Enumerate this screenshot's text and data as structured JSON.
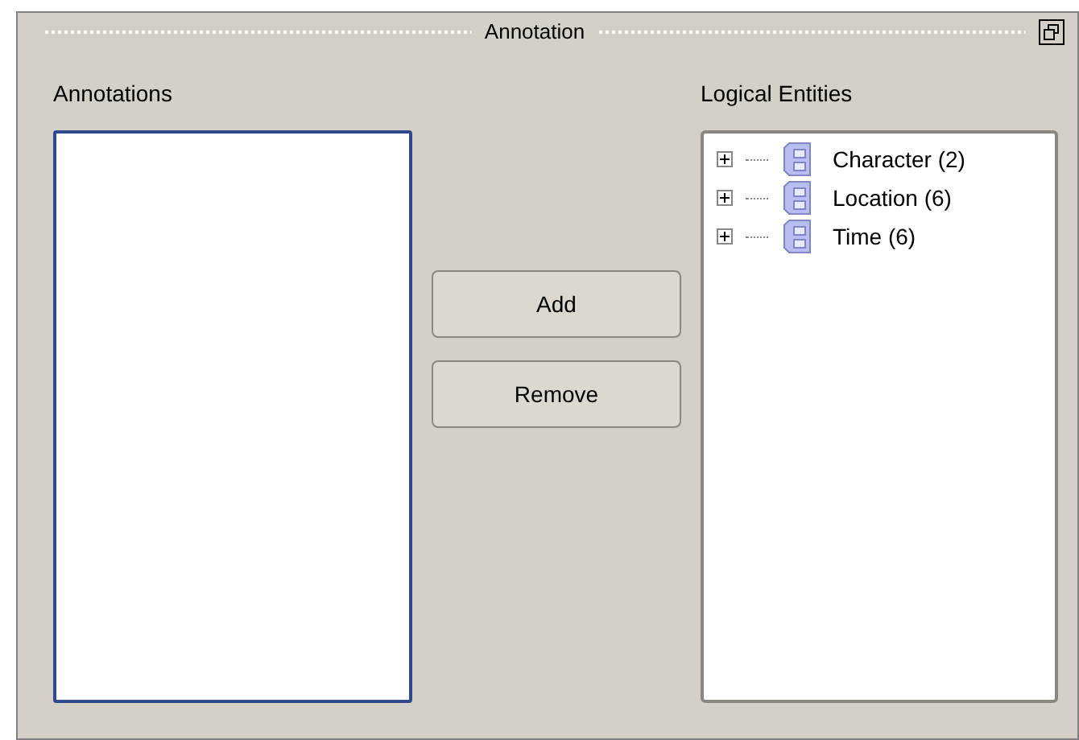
{
  "window": {
    "title": "Annotation"
  },
  "annotations": {
    "label": "Annotations"
  },
  "buttons": [
    "Add",
    "Remove"
  ],
  "logical_entities": {
    "label": "Logical Entities",
    "items": [
      {
        "label": "Character (2)",
        "expanded": false
      },
      {
        "label": "Location (6)",
        "expanded": false
      },
      {
        "label": "Time (6)",
        "expanded": false
      }
    ]
  }
}
